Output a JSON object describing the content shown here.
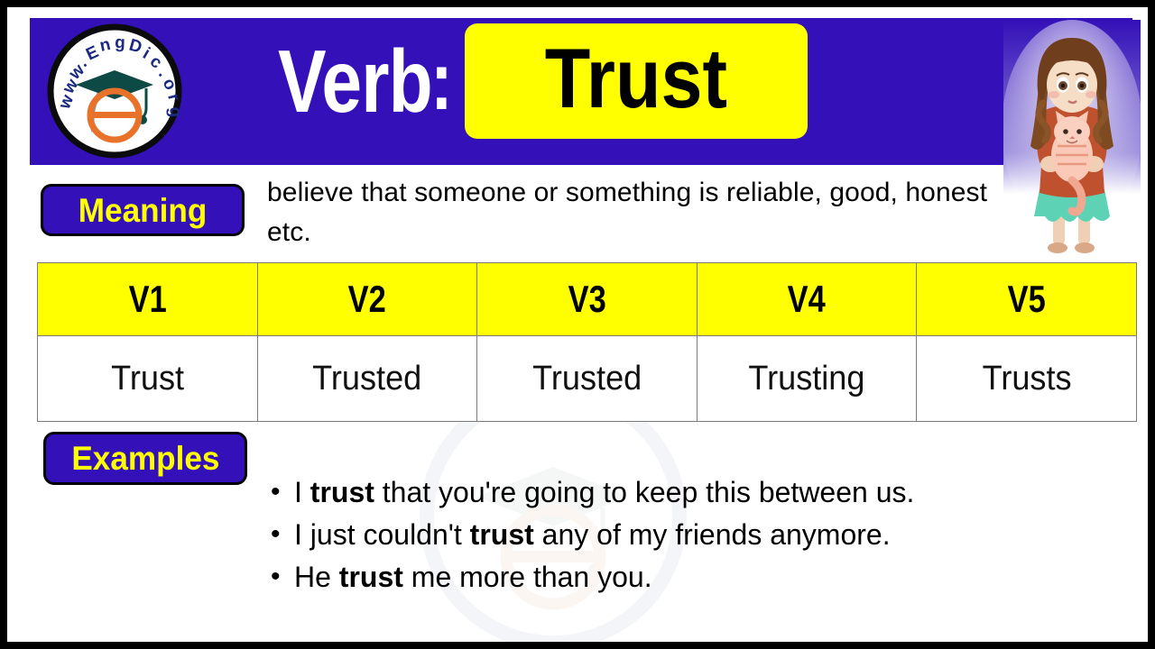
{
  "colors": {
    "frame": "#000000",
    "brand_blue": "#3310b8",
    "accent_yellow": "#ffff00",
    "page_background": "#ffffff",
    "table_border": "#7a7a7a"
  },
  "logo": {
    "name": "engdic-logo",
    "url_text_top": "www.",
    "url_text_main": "EngDic",
    "url_text_end": ".org",
    "full_text": "www.EngDic.org"
  },
  "header": {
    "label": "Verb",
    "separator": ":",
    "word": "Trust"
  },
  "meaning": {
    "badge_label": "Meaning",
    "text": "believe that someone or something is reliable, good, honest etc."
  },
  "forms_table": {
    "columns": [
      "V1",
      "V2",
      "V3",
      "V4",
      "V5"
    ],
    "row": [
      "Trust",
      "Trusted",
      "Trusted",
      "Trusting",
      "Trusts"
    ]
  },
  "examples": {
    "badge_label": "Examples",
    "items": [
      {
        "before": "I ",
        "bold": "trust",
        "after": " that you're going to keep this between us."
      },
      {
        "before": "I just couldn't ",
        "bold": "trust",
        "after": " any of my friends anymore."
      },
      {
        "before": "He ",
        "bold": "trust",
        "after": " me more than you."
      }
    ]
  },
  "illustration": {
    "name": "girl-holding-cat",
    "description": "Illustration of a girl with brown curly hair holding a striped cat"
  },
  "watermark": {
    "text": "www.EngDic.org"
  }
}
